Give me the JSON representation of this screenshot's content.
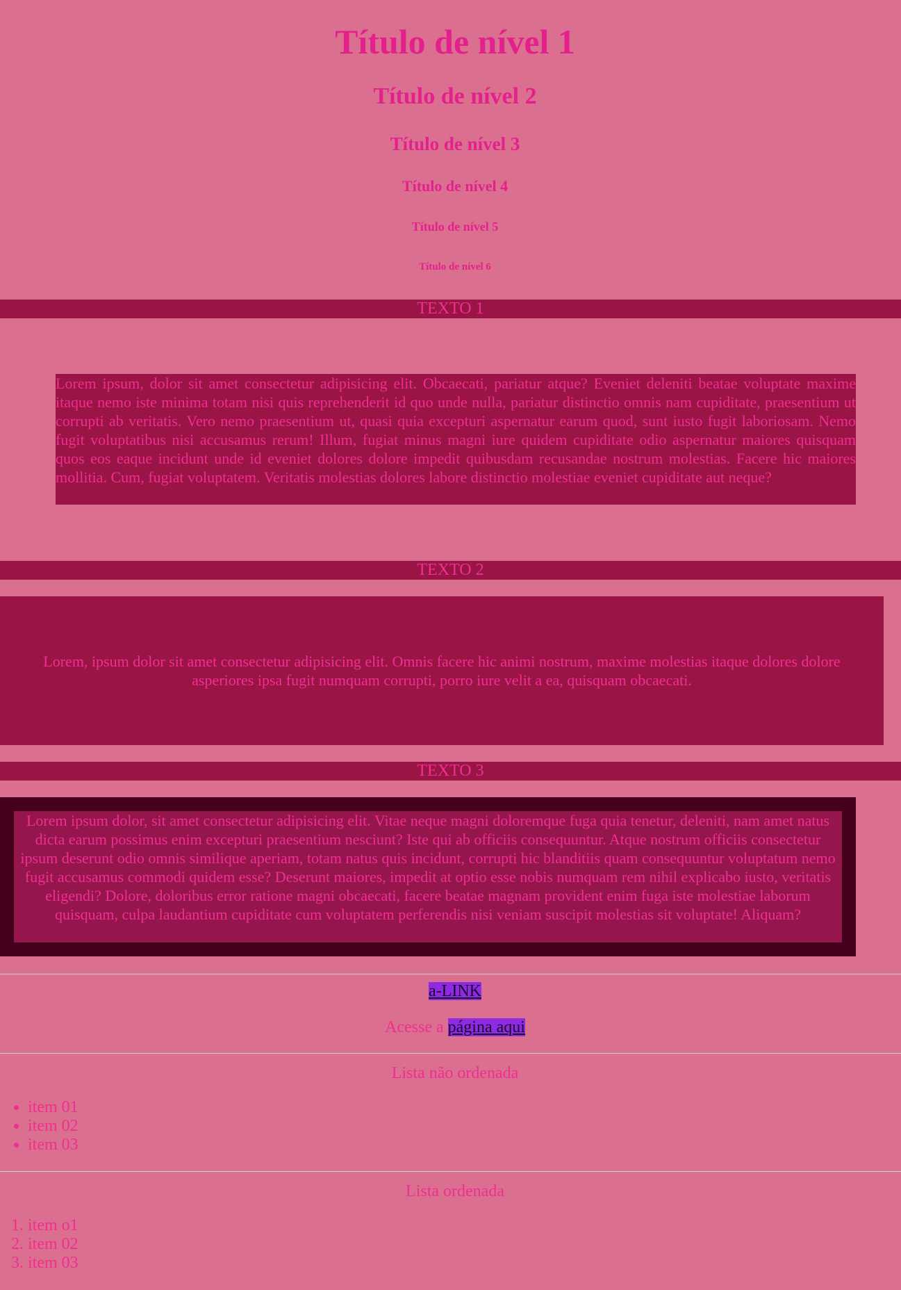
{
  "headings": {
    "h1": "Título de nível 1",
    "h2": "Título de nível 2",
    "h3": "Título de nível 3",
    "h4": "Título de nível 4",
    "h5": "Título de nível 5",
    "h6": "Título de nível 6"
  },
  "section1": {
    "title": "TEXTO 1",
    "text": "Lorem ipsum, dolor sit amet consectetur adipisicing elit. Obcaecati, pariatur atque? Eveniet deleniti beatae voluptate maxime itaque nemo iste minima totam nisi quis reprehenderit id quo unde nulla, pariatur distinctio omnis nam cupiditate, praesentium ut corrupti ab veritatis. Vero nemo praesentium ut, quasi quia excepturi aspernatur earum quod, sunt iusto fugit laboriosam. Nemo fugit voluptatibus nisi accusamus rerum! Illum, fugiat minus magni iure quidem cupiditate odio aspernatur maiores quisquam quos eos eaque incidunt unde id eveniet dolores dolore impedit quibusdam recusandae nostrum molestias. Facere hic maiores mollitia. Cum, fugiat voluptatem. Veritatis molestias dolores labore distinctio molestiae eveniet cupiditate aut neque?"
  },
  "section2": {
    "title": "TEXTO 2",
    "text": "Lorem, ipsum dolor sit amet consectetur adipisicing elit. Omnis facere hic animi nostrum, maxime molestias itaque dolores dolore asperiores ipsa fugit numquam corrupti, porro iure velit a ea, quisquam obcaecati."
  },
  "section3": {
    "title": "TEXTO 3",
    "text": "Lorem ipsum dolor, sit amet consectetur adipisicing elit. Vitae neque magni doloremque fuga quia tenetur, deleniti, nam amet natus dicta earum possimus enim excepturi praesentium nesciunt? Iste qui ab officiis consequuntur. Atque nostrum officiis consectetur ipsum deserunt odio omnis similique aperiam, totam natus quis incidunt, corrupti hic blanditiis quam consequuntur voluptatum nemo fugit accusamus commodi quidem esse? Deserunt maiores, impedit at optio esse nobis numquam rem nihil explicabo iusto, veritatis eligendi? Dolore, doloribus error ratione magni obcaecati, facere beatae magnam provident enim fuga iste molestiae laborum quisquam, culpa laudantium cupiditate cum voluptatem perferendis nisi veniam suscipit molestias sit voluptate! Aliquam?"
  },
  "links": {
    "a_link": "a-LINK",
    "access_prefix": "Acesse a ",
    "access_link": "página aqui"
  },
  "unordered": {
    "title": "Lista não ordenada",
    "items": [
      "item 01",
      "item 02",
      "item 03"
    ]
  },
  "ordered": {
    "title": "Lista ordenada",
    "items": [
      "item o1",
      "item 02",
      "item 03"
    ]
  },
  "colors": {
    "background": "#db6f8f",
    "text": "#e91e8c",
    "band": "#9a1445",
    "dark_border": "#45001c",
    "link_bg": "#8e2be2"
  }
}
